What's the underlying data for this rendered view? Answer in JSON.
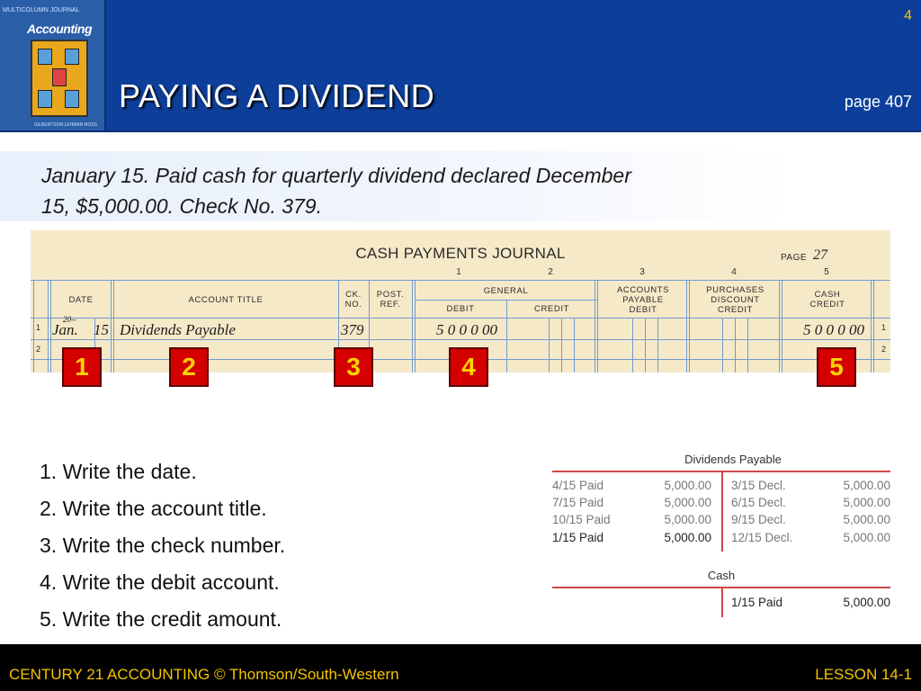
{
  "header": {
    "slide_number": "4",
    "title": "PAYING A DIVIDEND",
    "page_ref": "page 407",
    "cover": {
      "top_text": "MULTICOLUMN JOURNAL",
      "title": "Accounting",
      "footer_text": "GILBERTSON  LEHMAN  ROSS"
    }
  },
  "instruction": {
    "line1": "January 15.  Paid cash for quarterly dividend declared December",
    "line2": "15, $5,000.00.  Check No. 379."
  },
  "journal": {
    "title": "CASH PAYMENTS JOURNAL",
    "page_label": "PAGE",
    "page_number": "27",
    "column_numbers": [
      "1",
      "2",
      "3",
      "4",
      "5"
    ],
    "headers": {
      "date": "DATE",
      "account_title": "ACCOUNT TITLE",
      "ck_no": [
        "CK.",
        "NO."
      ],
      "post_ref": [
        "POST.",
        "REF."
      ],
      "general": "GENERAL",
      "general_debit": "DEBIT",
      "general_credit": "CREDIT",
      "accounts_payable_debit": [
        "ACCOUNTS",
        "PAYABLE",
        "DEBIT"
      ],
      "purchases_discount_credit": [
        "PURCHASES",
        "DISCOUNT",
        "CREDIT"
      ],
      "cash_credit": [
        "CASH",
        "CREDIT"
      ]
    },
    "row_numbers": [
      "1",
      "2"
    ],
    "entry": {
      "year": "20--",
      "month": "Jan.",
      "day": "15",
      "account_title": "Dividends Payable",
      "ck_no": "379",
      "general_debit": "5 0 0 0 00",
      "cash_credit": "5 0 0 0 00"
    }
  },
  "callouts": [
    "1",
    "2",
    "3",
    "4",
    "5"
  ],
  "steps": [
    "1.  Write the date.",
    "2.  Write the account title.",
    "3.  Write the check number.",
    "4.  Write the debit account.",
    "5.  Write the credit amount."
  ],
  "t_accounts": {
    "dividends_payable": {
      "name": "Dividends Payable",
      "debits": [
        {
          "label": "4/15 Paid",
          "amount": "5,000.00"
        },
        {
          "label": "7/15 Paid",
          "amount": "5,000.00"
        },
        {
          "label": "10/15 Paid",
          "amount": "5,000.00"
        },
        {
          "label": "1/15 Paid",
          "amount": "5,000.00"
        }
      ],
      "credits": [
        {
          "label": "3/15 Decl.",
          "amount": "5,000.00"
        },
        {
          "label": "6/15 Decl.",
          "amount": "5,000.00"
        },
        {
          "label": "9/15 Decl.",
          "amount": "5,000.00"
        },
        {
          "label": "12/15 Decl.",
          "amount": "5,000.00"
        }
      ]
    },
    "cash": {
      "name": "Cash",
      "credits": [
        {
          "label": "1/15 Paid",
          "amount": "5,000.00"
        }
      ]
    }
  },
  "footer": {
    "left": "CENTURY 21 ACCOUNTING © Thomson/South-Western",
    "right": "LESSON  14-1"
  },
  "colors": {
    "header_bg": "#0d3f9a",
    "accent_yellow": "#f5c400",
    "callout_red": "#d40000",
    "journal_bg": "#f6e9c8",
    "t_account_line": "#d04848"
  }
}
